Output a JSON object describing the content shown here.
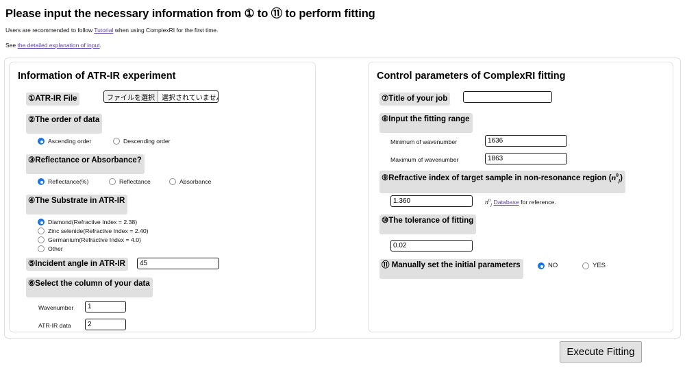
{
  "header": {
    "title_pre": "Please input the necessary information from ",
    "title_num1": "①",
    "title_mid": " to ",
    "title_num2": "⑪",
    "title_post": " to perform fitting",
    "note1_pre": "Users are recommended to follow ",
    "note1_link": "Tutorial",
    "note1_post": " when using ComplexRI for the first time.",
    "note2_pre": "See ",
    "note2_link": "the detailed explanation of input",
    "note2_post": "."
  },
  "left_panel": {
    "title": "Information of ATR-IR experiment",
    "q1": {
      "label": "①ATR-IR File",
      "file_button": "ファイルを選択",
      "file_status": "選択されていません"
    },
    "q2": {
      "label": "②The order of data",
      "options": [
        {
          "label": "Ascending order",
          "selected": true
        },
        {
          "label": "Descending order",
          "selected": false
        }
      ]
    },
    "q3": {
      "label": "③Reflectance or Absorbance?",
      "options": [
        {
          "label": "Reflectance(%)",
          "selected": true
        },
        {
          "label": "Reflectance",
          "selected": false
        },
        {
          "label": "Absorbance",
          "selected": false
        }
      ]
    },
    "q4": {
      "label": "④The Substrate in ATR-IR",
      "options": [
        {
          "label": "Diamond(Refractive Index = 2.38)",
          "selected": true
        },
        {
          "label": "Zinc selenide(Refractive Index = 2.40)",
          "selected": false
        },
        {
          "label": "Germanium(Refractive Index = 4.0)",
          "selected": false
        },
        {
          "label": "Other",
          "selected": false
        }
      ]
    },
    "q5": {
      "label": "⑤Incident angle in ATR-IR",
      "value": "45"
    },
    "q6": {
      "label": "⑥Select the column of your data",
      "rows": [
        {
          "label": "Wavenumber",
          "value": "1"
        },
        {
          "label": "ATR-IR data",
          "value": "2"
        }
      ]
    }
  },
  "right_panel": {
    "title": "Control parameters of ComplexRI fitting",
    "q7": {
      "label": "⑦Title of your job",
      "value": ""
    },
    "q8": {
      "label": "⑧Input the fitting range",
      "rows": [
        {
          "label": "Minimum of wavenumber",
          "value": "1636"
        },
        {
          "label": "Maximum of wavenumber",
          "value": "1863"
        }
      ]
    },
    "q9": {
      "label_pre": "⑨Refractive index of target sample in non-resonance region (",
      "label_symbol": "n",
      "label_sup": "0",
      "label_sub": "j",
      "label_post": ")",
      "value": "1.360",
      "db_symbol": "n",
      "db_sup": "0",
      "db_sub": "j",
      "db_link": "Database",
      "db_post": " for reference."
    },
    "q10": {
      "label": "⑩The tolerance of fitting",
      "value": "0.02"
    },
    "q11": {
      "label": "⑪ Manually set the initial parameters",
      "options": [
        {
          "label": "NO",
          "selected": true
        },
        {
          "label": "YES",
          "selected": false
        }
      ]
    }
  },
  "footer": {
    "execute_label": "Execute Fitting"
  },
  "colors": {
    "label_highlight": "#e0e0e0",
    "radio_selected": "#1a73e8",
    "link": "#5b3fa8",
    "panel_border": "#e2e2e2",
    "button_face": "#e2e2e2"
  }
}
